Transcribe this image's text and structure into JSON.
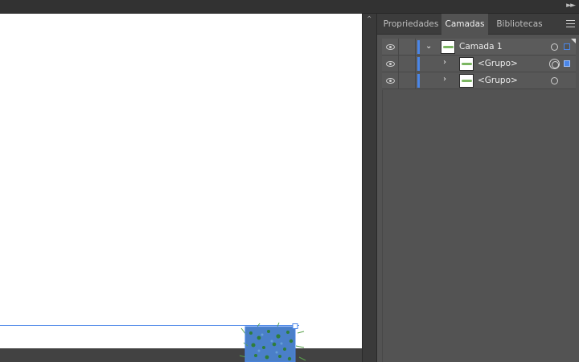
{
  "panel": {
    "tabs": [
      {
        "label": "Propriedades",
        "active": false
      },
      {
        "label": "Camadas",
        "active": true
      },
      {
        "label": "Bibliotecas",
        "active": false
      }
    ],
    "menu_icon": "hamburger-menu-icon"
  },
  "layers": [
    {
      "name": "Camada 1",
      "visible": true,
      "expanded": true,
      "level": 0,
      "color": "#4a86e8",
      "selected": false
    },
    {
      "name": "<Grupo>",
      "visible": true,
      "expanded": false,
      "level": 1,
      "color": "#4a86e8",
      "selected": true
    },
    {
      "name": "<Grupo>",
      "visible": true,
      "expanded": false,
      "level": 1,
      "color": "#4a86e8",
      "selected": false
    }
  ],
  "colors": {
    "selection": "#4a86e8",
    "artwork_fill": "#4a7fc8",
    "artwork_accent": "#2e8b3a"
  }
}
